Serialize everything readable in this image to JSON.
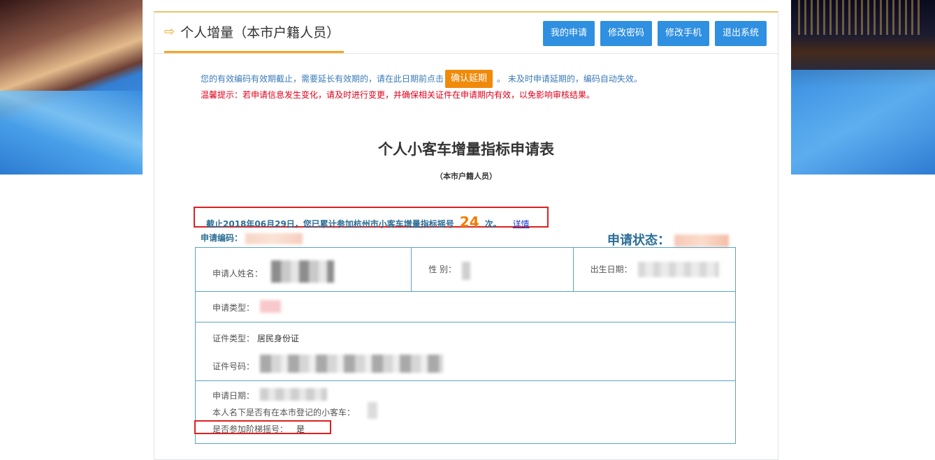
{
  "header": {
    "title": "个人增量（本市户籍人员）",
    "buttons": [
      "我的申请",
      "修改密码",
      "修改手机",
      "退出系统"
    ]
  },
  "notice": {
    "line1_before": "您的有效编码有效期截止，需要延长有效期的，请在此日期前点击",
    "confirm_button": "确认延期",
    "line1_after": "。 未及时申请延期的，编码自动失效。",
    "line2": "温馨提示：若申请信息发生变化，请及时进行变更，并确保相关证件在申请期内有效，以免影响审核结果。"
  },
  "form": {
    "title": "个人小客车增量指标申请表",
    "subtitle": "（本市户籍人员）",
    "count_before": "截止2018年06月29日，您已累计参加杭州市小客车增量指标摇号",
    "count_value": "24",
    "count_after": "次。",
    "detail_link": "详情",
    "code_label": "申请编码：",
    "status_label": "申请状态："
  },
  "table": {
    "name_label": "申请人姓名：",
    "gender_label": "性 别：",
    "birth_label": "出生日期：",
    "type_label": "申请类型：",
    "id_type_label": "证件类型：",
    "id_type_value": "居民身份证",
    "id_number_label": "证件号码：",
    "apply_date_label": "申请日期：",
    "has_car_label": "本人名下是否有在本市登记的小客车：",
    "tiered_label": "是否参加阶梯摇号：",
    "tiered_value": "是"
  },
  "colors": {
    "accent": "#2f8fe0",
    "orange": "#f08a0a",
    "alert": "#e02020",
    "label": "#2c6e96"
  }
}
